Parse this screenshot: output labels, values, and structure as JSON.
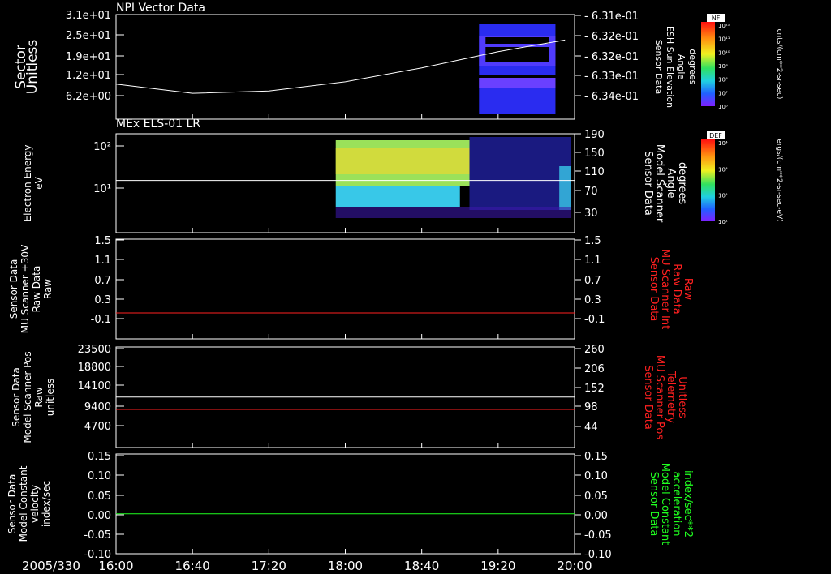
{
  "footer": {
    "date": "2005/330"
  },
  "x_ticks": [
    "16:00",
    "16:40",
    "17:20",
    "18:00",
    "18:40",
    "19:20",
    "20:00"
  ],
  "chart_data": [
    {
      "type": "heatmap",
      "title": "NPI Vector Data",
      "ylabel": [
        "Sector",
        "Unitless"
      ],
      "yticks": [
        "3.1e+01",
        "2.5e+01",
        "1.9e+01",
        "1.2e+01",
        "6.2e+00"
      ],
      "y2label": [
        "Sensor Data",
        "ESH Sun Elevation",
        "Angle",
        "degrees"
      ],
      "y2ticks": [
        "6.31e-01",
        "6.32e-01",
        "6.32e-01",
        "6.33e-01",
        "6.34e-01"
      ],
      "colorbar": {
        "label": "NF",
        "unit": "cnts/(cm**2-sr-sec)",
        "ticks": [
          "10¹²",
          "10¹¹",
          "10¹⁰",
          "10⁹",
          "10⁸",
          "10⁷",
          "10⁶"
        ]
      },
      "coverage": [
        {
          "x_start": "19:10",
          "x_end": "19:50"
        }
      ],
      "line": {
        "x": [
          "16:00",
          "16:40",
          "17:20",
          "18:00",
          "18:40",
          "19:20",
          "19:55"
        ],
        "y": [
          -0.6335,
          -0.6339,
          -0.6338,
          -0.6334,
          -0.6328,
          -0.6321,
          -0.6316
        ]
      },
      "line_color": "#ffffff"
    },
    {
      "type": "heatmap",
      "title": "MEx ELS-01 LR",
      "ylabel": [
        "Electron Energy",
        "eV"
      ],
      "yticks": [
        "10²",
        "10¹"
      ],
      "y2label": [
        "Sensor Data",
        "Model Scanner",
        "Angle",
        "degrees"
      ],
      "y2ticks": [
        "190",
        "150",
        "110",
        "70",
        "30"
      ],
      "colorbar": {
        "label": "DEF",
        "unit": "ergs/(cm**2-sr-sec-eV)",
        "ticks": [
          "10⁴",
          "10³",
          "10²",
          "10¹"
        ]
      },
      "coverage": [
        {
          "x_start": "17:55",
          "x_end": "19:58"
        }
      ],
      "line": {
        "x": [
          "16:00",
          "20:00"
        ],
        "y": [
          95,
          95
        ]
      },
      "line_color": "#ffffff"
    },
    {
      "type": "line",
      "ylabel": [
        "Sensor Data",
        "MU Scanner +30V",
        "Raw Data",
        "Raw"
      ],
      "yticks": [
        "1.5",
        "1.1",
        "0.7",
        "0.3",
        "-0.1"
      ],
      "y2label": [
        "Sensor Data",
        "MU Scanner Int",
        "Raw Data",
        "Raw"
      ],
      "y2ticks": [
        "1.5",
        "1.1",
        "0.7",
        "0.3",
        "-0.1"
      ],
      "ylim": [
        -0.3,
        1.5
      ],
      "series": [
        {
          "x": [
            "16:00",
            "20:00"
          ],
          "values": [
            0.0,
            0.0
          ],
          "color": "#ff2020"
        }
      ]
    },
    {
      "type": "line",
      "ylabel": [
        "Sensor Data",
        "Model Scanner Pos",
        "Raw",
        "unitless"
      ],
      "yticks": [
        "23500",
        "18800",
        "14100",
        "9400",
        "4700"
      ],
      "y2label": [
        "Sensor Data",
        "MU Scanner Pos",
        "Telemetry",
        "Unitless"
      ],
      "y2ticks": [
        "260",
        "206",
        "152",
        "98",
        "44"
      ],
      "ylim": [
        0,
        23500
      ],
      "y2lim": [
        -10,
        260
      ],
      "series": [
        {
          "x": [
            "16:00",
            "20:00"
          ],
          "values": [
            11800,
            11800
          ],
          "color": "#ffffff"
        },
        {
          "x": [
            "16:00",
            "20:00"
          ],
          "values": [
            8900,
            8900
          ],
          "color": "#ff2020"
        }
      ]
    },
    {
      "type": "line",
      "ylabel": [
        "Sensor Data",
        "Model Constant",
        "velocity",
        "index/sec"
      ],
      "yticks": [
        "0.15",
        "0.10",
        "0.05",
        "0.00",
        "-0.05",
        "-0.10"
      ],
      "y2label": [
        "Sensor Data",
        "Model Constant",
        "acceleration",
        "index/sec**2"
      ],
      "y2ticks": [
        "0.15",
        "0.10",
        "0.05",
        "0.00",
        "-0.05",
        "-0.10"
      ],
      "ylim": [
        -0.1,
        0.15
      ],
      "series": [
        {
          "x": [
            "16:00",
            "20:00"
          ],
          "values": [
            0.0,
            0.0
          ],
          "color": "#20ff20"
        }
      ]
    }
  ],
  "colors": {
    "frame": "#ffffff",
    "red_label": "#ff2020",
    "green_label": "#20ff20"
  }
}
